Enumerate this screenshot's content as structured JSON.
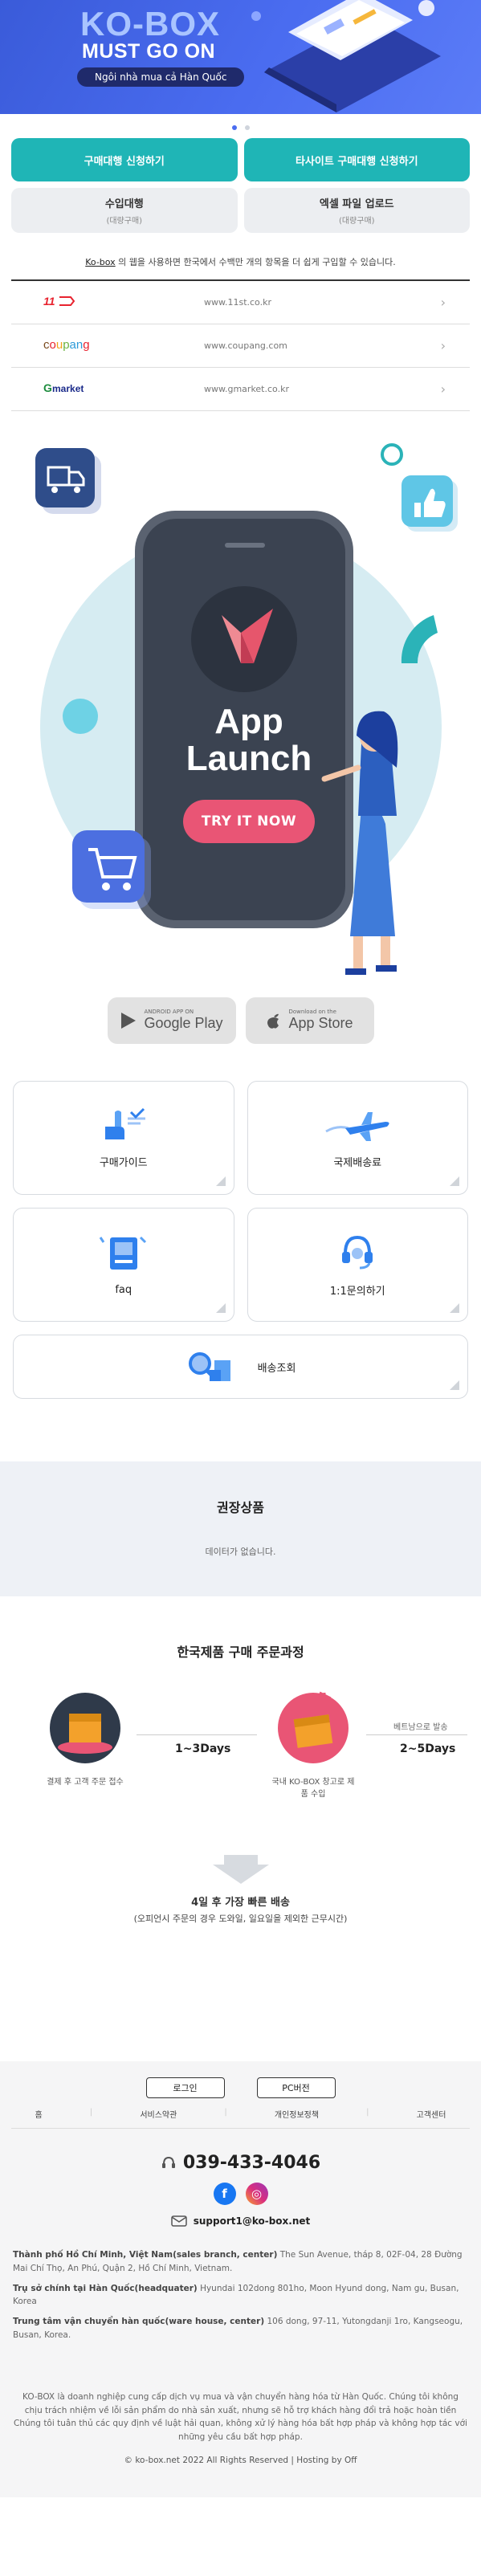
{
  "hero": {
    "brand": "KO-BOX",
    "tagline": "MUST GO ON",
    "subtitle": "Ngôi nhà mua cả Hàn Quốc",
    "carousel": {
      "count": 2,
      "active": 1
    }
  },
  "actions": {
    "purchase_agent": "구매대행 신청하기",
    "other_site_agent": "타사이트 구매대행 신청하기",
    "import_agent": {
      "main": "수입대행",
      "sub": "(대량구매)"
    },
    "excel_upload": {
      "main": "엑셀 파일 업로드",
      "sub": "(대량구매)"
    }
  },
  "malls": {
    "notice_brand": "Ko-box",
    "notice_rest": " 의 웹을 사용하면 한국에서 수백만 개의 항목을 더 쉽게 구입할 수 있습니다.",
    "items": [
      {
        "logo": "11st-logo",
        "url": "www.11st.co.kr"
      },
      {
        "logo": "coupang-logo",
        "url": "www.coupang.com"
      },
      {
        "logo": "gmarket-logo",
        "url": "www.gmarket.co.kr"
      }
    ]
  },
  "app_launch": {
    "title_line1": "App",
    "title_line2": "Launch",
    "cta": "TRY IT NOW",
    "google_play_small": "ANDROID APP ON",
    "google_play": "Google Play",
    "app_store_small": "Download on the",
    "app_store": "App Store"
  },
  "services": {
    "purchase_guide": "구매가이드",
    "intl_shipping": "국제배송료",
    "faq": "faq",
    "inquiry": "1:1문의하기",
    "delivery_tracking": "배송조회"
  },
  "recommend": {
    "title": "권장상품",
    "empty": "데이터가 없습니다."
  },
  "process": {
    "title": "한국제품 구매 주문과정",
    "step1": "결제 후 고객 주문 접수",
    "days1": "1~3Days",
    "step2": "국내 KO-BOX 창고로 제품 수입",
    "days2": "2~5Days",
    "note2": "베트남으로 발송",
    "final_title": "4일 후 가장 빠른 배송",
    "final_sub": "(오피언시 주문의 경우 도와일, 일요일을 제외한 근무시간)"
  },
  "footer": {
    "login": "로그인",
    "pc_version": "PC버전",
    "links": [
      "홈",
      "서비스약관",
      "개인정보정책",
      "고객센터"
    ],
    "phone": "039-433-4046",
    "email": "support1@ko-box.net",
    "addr1_label": "Thành phố Hồ Chí Minh, Việt Nam(sales branch, center)",
    "addr1": " The Sun Avenue, tháp 8, 02F-04, 28 Đường Mai Chí Thọ, An Phú, Quận 2, Hồ Chí Minh, Vietnam.",
    "addr2_label": "Trụ sở chính tại Hàn Quốc(headquater)",
    "addr2": " Hyundai 102dong 801ho, Moon Hyund dong, Nam gu, Busan, Korea",
    "addr3_label": "Trung tâm vận chuyển hàn quốc(ware house, center)",
    "addr3": " 106 dong, 97-11, Yutongdanji 1ro, Kangseogu, Busan, Korea.",
    "disclaimer": "KO-BOX là doanh nghiệp cung cấp dịch vụ mua và vận chuyển hàng hóa từ Hàn Quốc. Chúng tôi không chịu trách nhiệm về lỗi sản phẩm do nhà sản xuất, nhưng sẽ hỗ trợ khách hàng đổi trả hoặc hoàn tiền Chúng tôi tuân thủ các quy định về luật hải quan, không xử lý hàng hóa bất hợp pháp và không hợp tác với những yêu cầu bất hợp pháp.",
    "copyright": "© ko-box.net 2022 All Rights Reserved | Hosting by Off"
  },
  "colors": {
    "hero": "#4a6cf0",
    "teal": "#1fb5b6",
    "cta": "#e95575",
    "phone_body": "#3b4351",
    "accent_blue": "#2f80ed"
  }
}
